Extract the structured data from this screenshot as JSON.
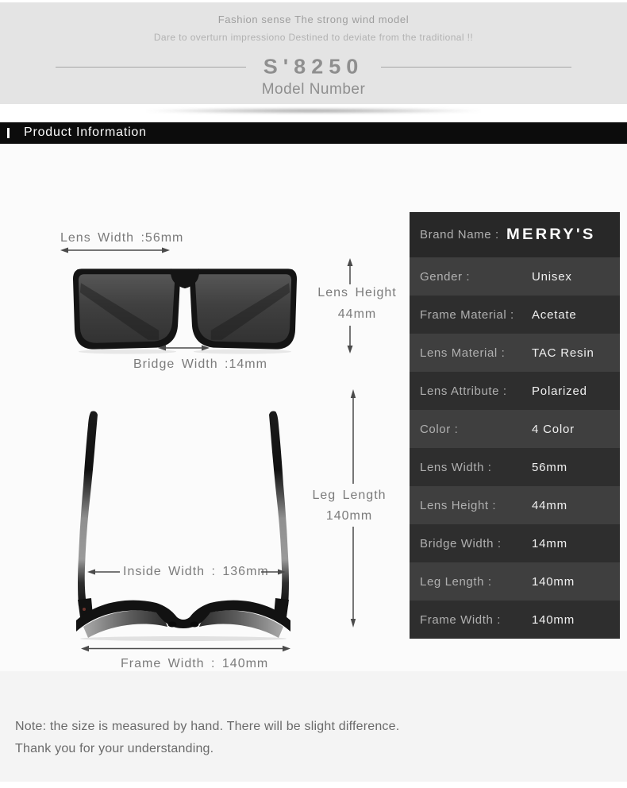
{
  "header": {
    "tagline1": "Fashion sense The strong wind model",
    "tagline2": "Dare to overturn impressiono Destined to deviate from the traditional !!",
    "model_number": "S'8250",
    "model_label": "Model Number"
  },
  "product_info_bar": {
    "title": "Product Information"
  },
  "diagram": {
    "front_view": {
      "lens_width": "Lens Width :56mm",
      "lens_height_line1": "Lens Height",
      "lens_height_line2": "44mm",
      "bridge_width": "Bridge Width :14mm"
    },
    "top_view": {
      "inside_width": "Inside Width : 136mm",
      "leg_length_line1": "Leg Length",
      "leg_length_line2": "140mm",
      "frame_width": "Frame Width : 140mm"
    }
  },
  "spec_table": {
    "brand": {
      "label": "Brand Name :",
      "value": "MERRY'S"
    },
    "rows": [
      {
        "label": "Gender :",
        "value": "Unisex"
      },
      {
        "label": "Frame Material :",
        "value": "Acetate"
      },
      {
        "label": "Lens Material :",
        "value": "TAC Resin"
      },
      {
        "label": "Lens Attribute :",
        "value": "Polarized"
      },
      {
        "label": "Color :",
        "value": "4 Color"
      },
      {
        "label": "Lens Width :",
        "value": "56mm"
      },
      {
        "label": "Lens Height :",
        "value": "44mm"
      },
      {
        "label": "Bridge Width :",
        "value": "14mm"
      },
      {
        "label": "Leg Length :",
        "value": "140mm"
      },
      {
        "label": "Frame Width :",
        "value": "140mm"
      }
    ]
  },
  "note": {
    "line1": "Note: the size is measured by hand. There will be slight difference.",
    "line2": "Thank you for your understanding."
  },
  "colors": {
    "header_bg": "#e4e4e4",
    "section_bar_bg": "#0c0c0c",
    "brand_row_bg": "#282828",
    "row_dark": "#2e2e2e",
    "row_light": "#3f3f3f",
    "table_label_text": "#b0b0b0",
    "table_value_text": "#f0f0f0",
    "measure_text": "#7b7b7b",
    "arrow": "#4a4a4a",
    "note_text": "#6a6a6a"
  }
}
